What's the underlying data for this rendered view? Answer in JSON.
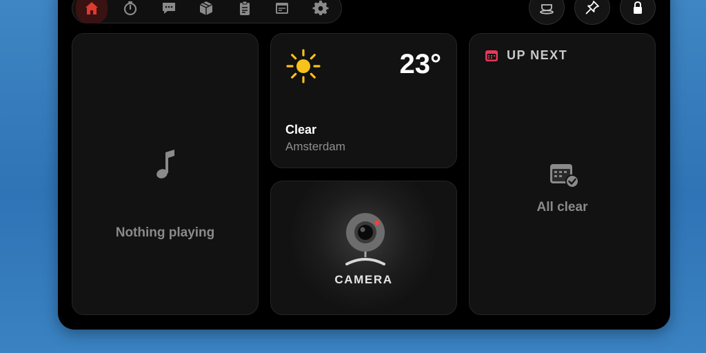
{
  "toolbar": {
    "tabs": [
      {
        "icon": "home-icon",
        "active": true
      },
      {
        "icon": "timer-icon",
        "active": false
      },
      {
        "icon": "chat-icon",
        "active": false
      },
      {
        "icon": "box-icon",
        "active": false
      },
      {
        "icon": "clipboard-icon",
        "active": false
      },
      {
        "icon": "screen-icon",
        "active": false
      },
      {
        "icon": "gear-icon",
        "active": false
      }
    ],
    "right_buttons": [
      "coffee-cup-icon",
      "pin-icon",
      "lock-icon"
    ],
    "accent": "#e0392f"
  },
  "music": {
    "status": "Nothing playing"
  },
  "weather": {
    "temperature": "23°",
    "condition": "Clear",
    "city": "Amsterdam",
    "icon": "sun-icon",
    "sun_color": "#f7c21b"
  },
  "camera": {
    "label": "CAMERA"
  },
  "up_next": {
    "title": "UP NEXT",
    "status": "All clear",
    "accent": "#e8385a"
  }
}
